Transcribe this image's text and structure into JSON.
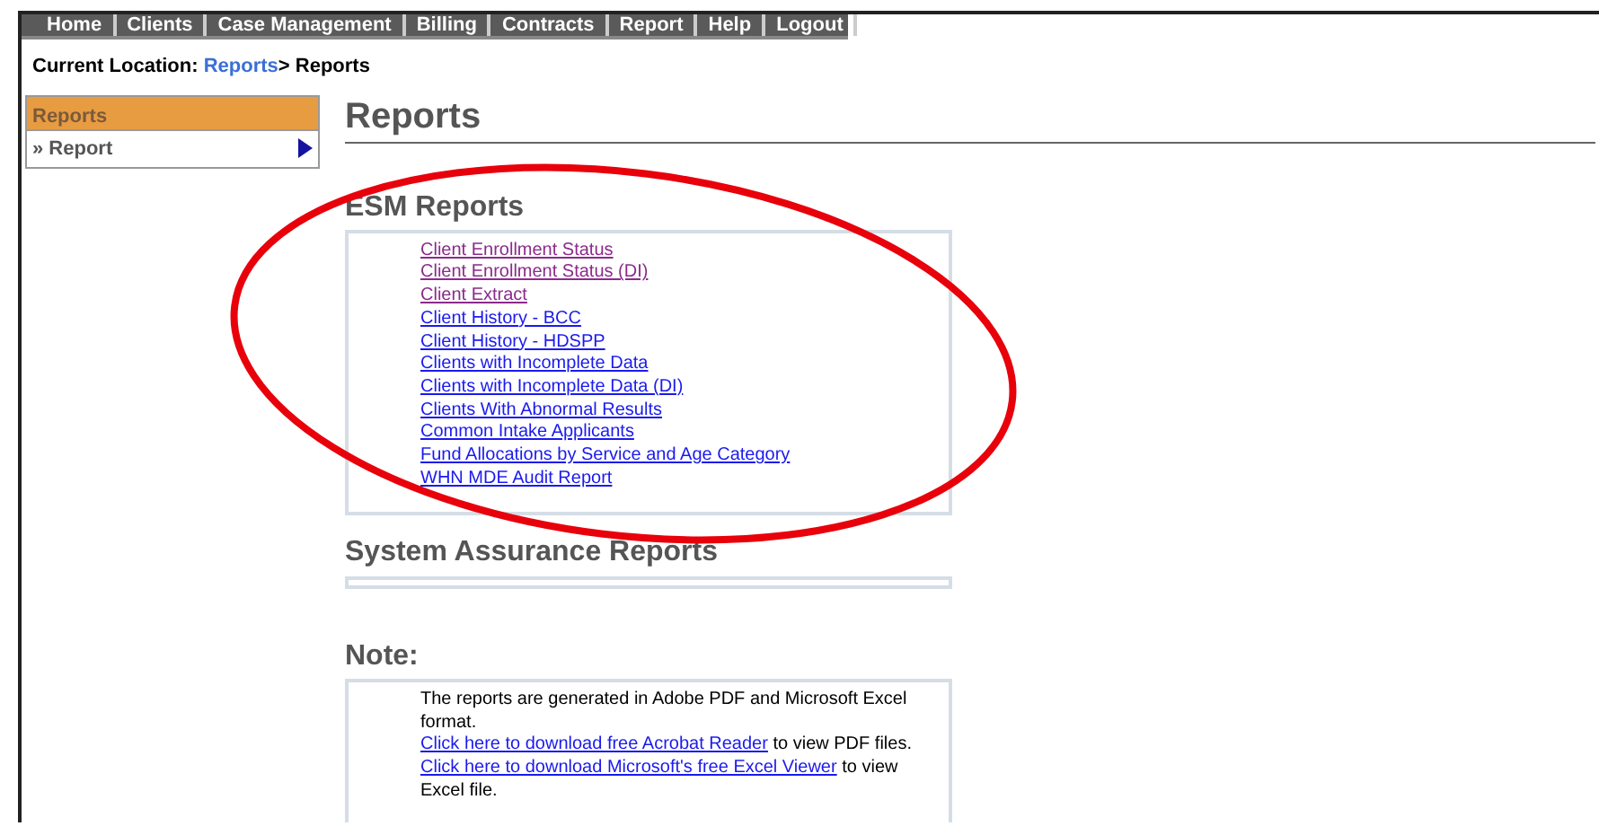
{
  "nav": [
    {
      "label": "Home"
    },
    {
      "label": "Clients"
    },
    {
      "label": "Case Management"
    },
    {
      "label": "Billing"
    },
    {
      "label": "Contracts"
    },
    {
      "label": "Report"
    },
    {
      "label": "Help"
    },
    {
      "label": "Logout"
    }
  ],
  "breadcrumb": {
    "label": "Current Location:",
    "link": "Reports",
    "current": "> Reports"
  },
  "sidebar": {
    "title": "Reports",
    "items": [
      {
        "label": "» Report",
        "selected": true
      }
    ]
  },
  "page_title": "Reports",
  "sections": [
    {
      "title": "ESM Reports",
      "links": [
        {
          "label": "Client Enrollment Status",
          "visited": true
        },
        {
          "label": "Client Enrollment Status (DI)",
          "visited": true
        },
        {
          "label": "Client Extract",
          "visited": true
        },
        {
          "label": "Client History - BCC",
          "visited": false
        },
        {
          "label": "Client History - HDSPP",
          "visited": false
        },
        {
          "label": "Clients with Incomplete Data",
          "visited": false
        },
        {
          "label": "Clients with Incomplete Data (DI)",
          "visited": false
        },
        {
          "label": "Clients With Abnormal Results",
          "visited": false
        },
        {
          "label": "Common Intake Applicants",
          "visited": false
        },
        {
          "label": "Fund Allocations by Service and Age Category",
          "visited": false
        },
        {
          "label": "WHN MDE Audit Report",
          "visited": false
        }
      ]
    },
    {
      "title": "System Assurance Reports"
    }
  ],
  "note": {
    "title": "Note:",
    "lines": [
      {
        "text": "The reports are generated in Adobe PDF and Microsoft Excel format."
      },
      {
        "link": "Click here to download free Acrobat Reader",
        "text": " to view PDF files."
      },
      {
        "link": "Click here to download Microsoft's free Excel Viewer",
        "text": " to view Excel file."
      }
    ]
  }
}
